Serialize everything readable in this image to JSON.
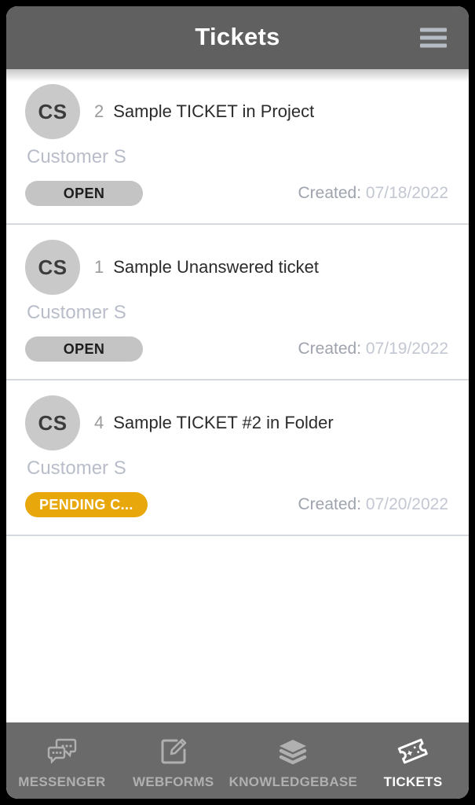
{
  "header": {
    "title": "Tickets",
    "menu_icon": "hamburger-menu-icon"
  },
  "tickets": [
    {
      "avatar_initials": "CS",
      "number": "2",
      "title": "Sample TICKET in Project",
      "customer": "Customer S",
      "status": "OPEN",
      "status_type": "open",
      "created_label": "Created:",
      "created_date": "07/18/2022"
    },
    {
      "avatar_initials": "CS",
      "number": "1",
      "title": "Sample Unanswered ticket",
      "customer": "Customer S",
      "status": "OPEN",
      "status_type": "open",
      "created_label": "Created:",
      "created_date": "07/19/2022"
    },
    {
      "avatar_initials": "CS",
      "number": "4",
      "title": "Sample TICKET #2 in Folder",
      "customer": "Customer S",
      "status": "PENDING C...",
      "status_type": "pending",
      "created_label": "Created:",
      "created_date": "07/20/2022"
    }
  ],
  "bottom_nav": {
    "items": [
      {
        "label": "MESSENGER",
        "icon": "chat-bubbles-icon",
        "active": false
      },
      {
        "label": "WEBFORMS",
        "icon": "form-pencil-icon",
        "active": false
      },
      {
        "label": "KNOWLEDGEBASE",
        "icon": "layers-stack-icon",
        "active": false
      },
      {
        "label": "TICKETS",
        "icon": "ticket-stub-icon",
        "active": true
      }
    ]
  },
  "colors": {
    "header_bg": "#606060",
    "nav_bg": "#6a6a6a",
    "status_open_bg": "#c4c4c4",
    "status_pending_bg": "#e8a80c",
    "avatar_bg": "#c9c9c9",
    "muted_text": "#b8bdc9",
    "device_frame": "#000000"
  }
}
